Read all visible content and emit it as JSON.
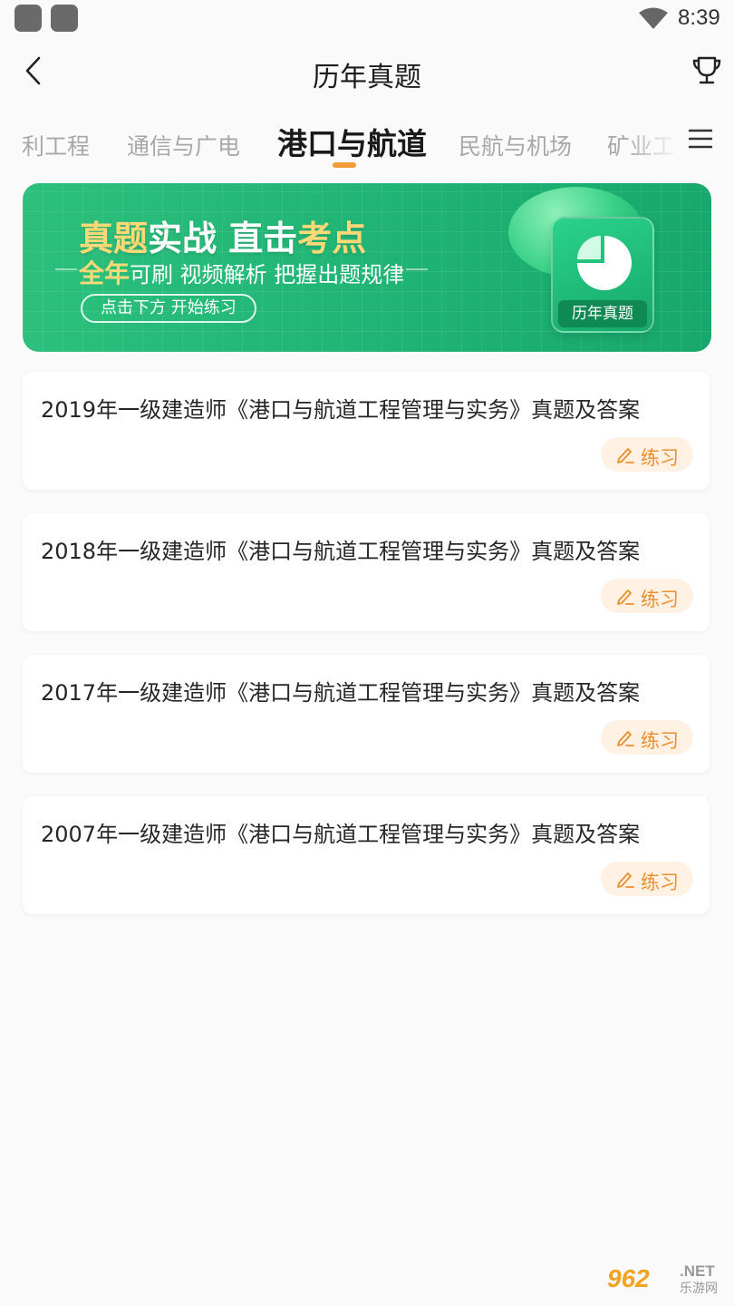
{
  "status_bar": {
    "time": "8:39"
  },
  "header": {
    "title": "历年真题"
  },
  "tabs": [
    {
      "label": "利工程",
      "active": false
    },
    {
      "label": "通信与广电",
      "active": false
    },
    {
      "label": "港口与航道",
      "active": true
    },
    {
      "label": "民航与机场",
      "active": false
    },
    {
      "label": "矿业工",
      "active": false
    }
  ],
  "banner": {
    "line1_a": "真题",
    "line1_b": "实战 直击",
    "line1_c": "考点",
    "line2_a": "全年",
    "line2_b": "可刷 视频解析 把握出题规律",
    "cta": "点击下方 开始练习",
    "card_label": "历年真题"
  },
  "exams": [
    {
      "title": "2019年一级建造师《港口与航道工程管理与实务》真题及答案",
      "action": "练习"
    },
    {
      "title": "2018年一级建造师《港口与航道工程管理与实务》真题及答案",
      "action": "练习"
    },
    {
      "title": "2017年一级建造师《港口与航道工程管理与实务》真题及答案",
      "action": "练习"
    },
    {
      "title": "2007年一级建造师《港口与航道工程管理与实务》真题及答案",
      "action": "练习"
    }
  ],
  "watermark": {
    "number": "962",
    "domain": ".NET",
    "sub": "乐游网"
  },
  "colors": {
    "accent": "#f29b38",
    "banner_green": "#1fb375",
    "practice_bg": "#fff1e3",
    "practice_text": "#ee8f2e"
  }
}
